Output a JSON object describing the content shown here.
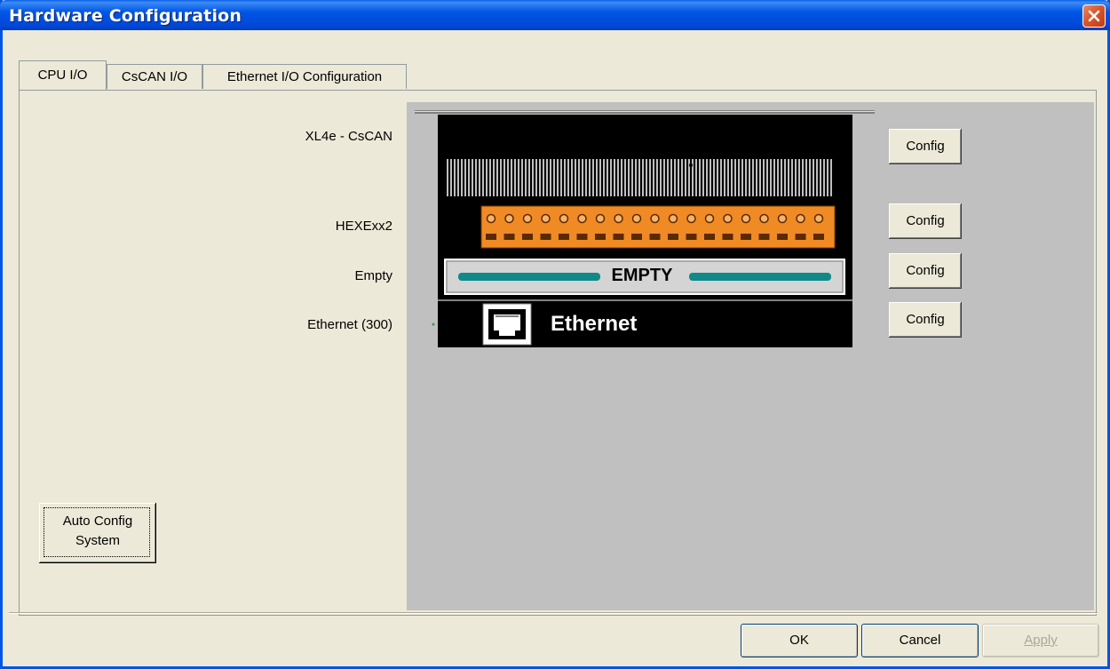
{
  "window": {
    "title": "Hardware Configuration"
  },
  "tabs": [
    {
      "label": "CPU I/O",
      "active": true
    },
    {
      "label": "CsCAN I/O",
      "active": false
    },
    {
      "label": "Ethernet I/O Configuration",
      "active": false
    }
  ],
  "modules": [
    {
      "label": "XL4e - CsCAN",
      "config_label": "Config"
    },
    {
      "label": "HEXExx2",
      "config_label": "Config"
    },
    {
      "label": "Empty",
      "config_label": "Config",
      "slot_text": "EMPTY"
    },
    {
      "label": "Ethernet (300)",
      "config_label": "Config",
      "slot_text": "Ethernet"
    }
  ],
  "auto_config": {
    "line1": "Auto Config",
    "line2": "System"
  },
  "footer": {
    "ok": "OK",
    "cancel": "Cancel",
    "apply": "Apply"
  },
  "colors": {
    "title_bar": "#0054e3",
    "rack_bg": "#c0c0c0",
    "terminal_orange": "#f08a24",
    "empty_bar_teal": "#0f8a88"
  }
}
